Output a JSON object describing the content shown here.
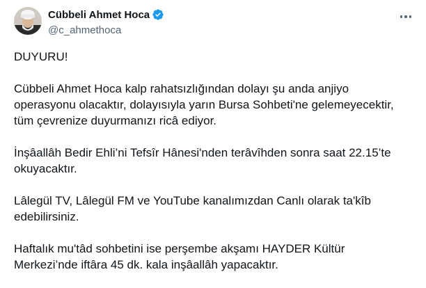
{
  "author": {
    "name": "Cübbeli Ahmet Hoca",
    "handle": "@c_ahmethoca",
    "verified_icon": "verified-badge-icon",
    "verified_color": "#1d9bf0"
  },
  "menu": {
    "icon": "more-options-icon"
  },
  "tweet": {
    "paragraphs": [
      [
        "DUYURU!"
      ],
      [
        "Cübbeli Ahmet Hoca kalp rahatsızlığından dolayı şu anda anjiyo",
        "operasyonu olacaktır, dolayısıyla yarın Bursa Sohbeti'ne gelemeyecektir,",
        "tüm çevrenize duyurmanızı ricâ ediyor."
      ],
      [
        "İnşâallâh Bedir Ehli’ni Tefsîr Hânesi'nden terâvîhden sonra saat 22.15’te",
        "okuyacaktır."
      ],
      [
        "Lâlegül TV, Lâlegül FM ve YouTube kanalımızdan Canlı olarak ta'kîb",
        "edebilirsiniz."
      ],
      [
        "Haftalık mu'tâd sohbetini ise perşembe akşamı HAYDER Kültür",
        "Merkezi’nde iftâra 45 dk. kala inşâallâh yapacaktır."
      ]
    ]
  }
}
